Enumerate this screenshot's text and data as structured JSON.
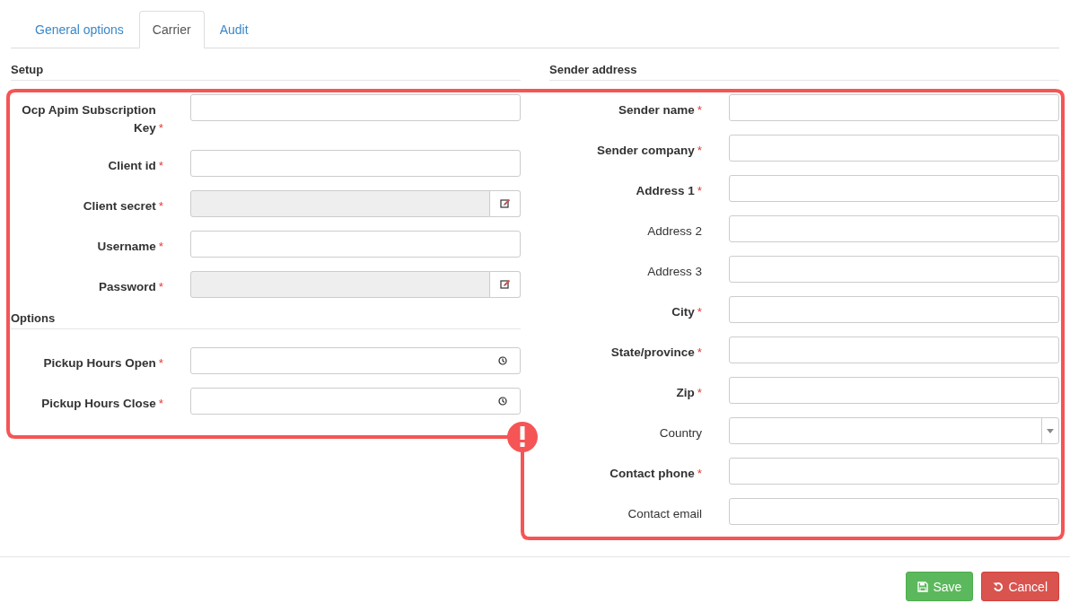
{
  "tabs": [
    {
      "label": "General options",
      "selected": false
    },
    {
      "label": "Carrier",
      "selected": true
    },
    {
      "label": "Audit",
      "selected": false
    }
  ],
  "left_sections": [
    {
      "title": "Setup",
      "fields": [
        {
          "label": "Ocp Apim Subscription Key",
          "asterisk": "*",
          "kind": "text"
        },
        {
          "label": "Client id",
          "asterisk": "*",
          "kind": "text"
        },
        {
          "label": "Client secret",
          "asterisk": "*",
          "kind": "locked"
        },
        {
          "label": "Username",
          "asterisk": "*",
          "kind": "text"
        },
        {
          "label": "Password",
          "asterisk": "*",
          "kind": "locked"
        }
      ]
    },
    {
      "title": "Options",
      "fields": [
        {
          "label": "Pickup Hours Open",
          "asterisk": "*",
          "kind": "time"
        },
        {
          "label": "Pickup Hours Close",
          "asterisk": "*",
          "kind": "time"
        }
      ]
    }
  ],
  "right_section": {
    "title": "Sender address",
    "fields": [
      {
        "label": "Sender name",
        "asterisk": "*",
        "kind": "text"
      },
      {
        "label": "Sender company",
        "asterisk": "*",
        "kind": "text"
      },
      {
        "label": "Address 1",
        "asterisk": "*",
        "kind": "text"
      },
      {
        "label": "Address 2",
        "kind": "text"
      },
      {
        "label": "Address 3",
        "kind": "text"
      },
      {
        "label": "City",
        "asterisk": "*",
        "kind": "text"
      },
      {
        "label": "State/province",
        "asterisk": "*",
        "kind": "text"
      },
      {
        "label": "Zip",
        "asterisk": "*",
        "kind": "text"
      },
      {
        "label": "Country",
        "kind": "select"
      },
      {
        "label": "Contact phone",
        "asterisk": "*",
        "kind": "text"
      },
      {
        "label": "Contact email",
        "kind": "text"
      }
    ]
  },
  "buttons": [
    {
      "label": "Save",
      "kind": "save"
    },
    {
      "label": "Cancel",
      "kind": "cancel"
    }
  ]
}
